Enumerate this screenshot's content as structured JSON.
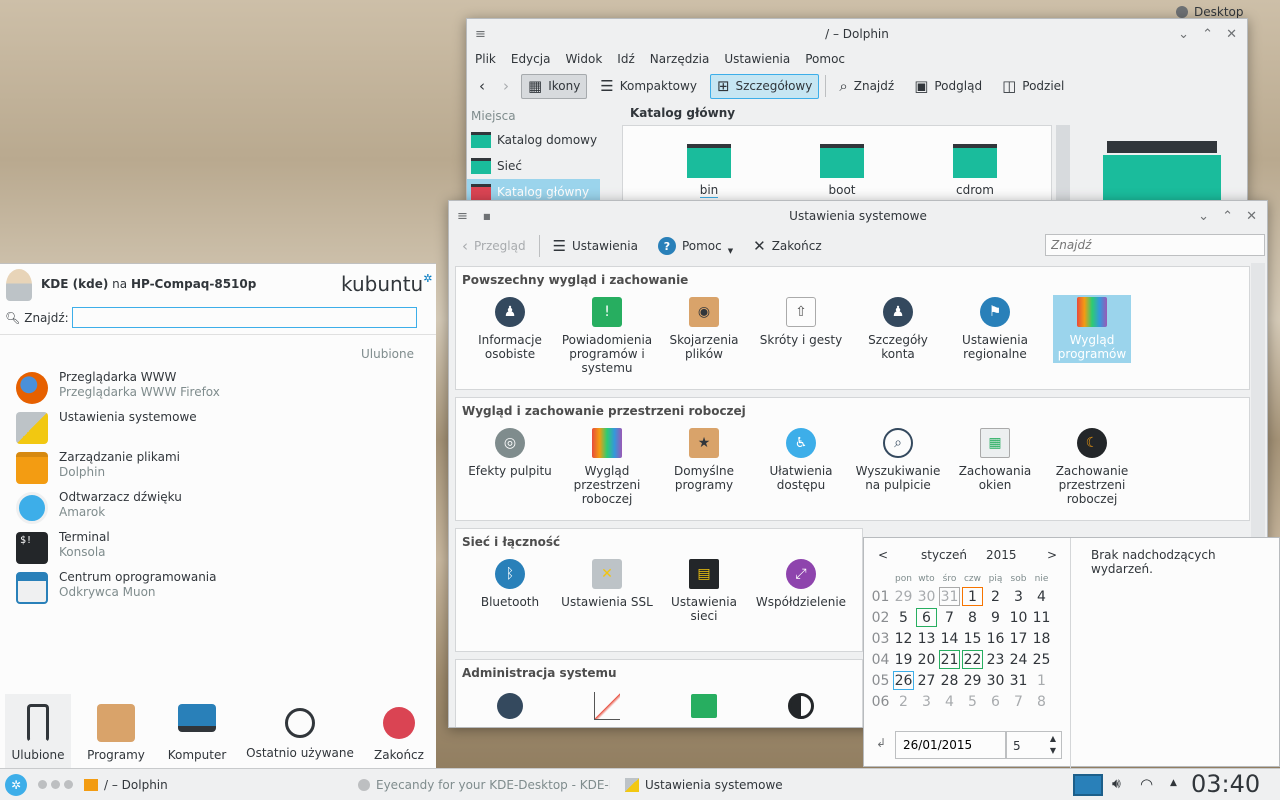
{
  "desktop": {
    "label": "Desktop"
  },
  "dolphin": {
    "title": "/ – Dolphin",
    "menu": [
      "Plik",
      "Edycja",
      "Widok",
      "Idź",
      "Narzędzia",
      "Ustawienia",
      "Pomoc"
    ],
    "toolbar": {
      "icons": "Ikony",
      "compact": "Kompaktowy",
      "details": "Szczegółowy",
      "find": "Znajdź",
      "preview": "Podgląd",
      "split": "Podziel"
    },
    "places_title": "Miejsca",
    "places": [
      "Katalog domowy",
      "Sieć",
      "Katalog główny"
    ],
    "location": "Katalog główny",
    "folders": [
      "bin",
      "boot",
      "cdrom"
    ]
  },
  "settings": {
    "title": "Ustawienia systemowe",
    "toolbar": {
      "overview": "Przegląd",
      "configure": "Ustawienia",
      "help": "Pomoc",
      "quit": "Zakończ"
    },
    "search_placeholder": "Znajdź",
    "sections": [
      {
        "title": "Powszechny wygląd i zachowanie",
        "modules": [
          "Informacje osobiste",
          "Powiadomienia programów i systemu",
          "Skojarzenia plików",
          "Skróty i gesty",
          "Szczegóły konta",
          "Ustawienia regionalne",
          "Wygląd programów"
        ]
      },
      {
        "title": "Wygląd i zachowanie przestrzeni roboczej",
        "modules": [
          "Efekty pulpitu",
          "Wygląd przestrzeni roboczej",
          "Domyślne programy",
          "Ułatwienia dostępu",
          "Wyszukiwanie na pulpicie",
          "Zachowania okien",
          "Zachowanie przestrzeni roboczej"
        ]
      },
      {
        "title": "Sieć i łączność",
        "modules": [
          "Bluetooth",
          "Ustawienia SSL",
          "Ustawienia sieci",
          "Współdzielenie"
        ]
      },
      {
        "title": "Administracja systemu",
        "modules": []
      }
    ]
  },
  "calendar": {
    "prev": "<",
    "next": ">",
    "month": "styczeń",
    "year": "2015",
    "weekdays": [
      "pon",
      "wto",
      "śro",
      "czw",
      "pią",
      "sob",
      "nie"
    ],
    "weeks": [
      {
        "wk": "01",
        "days": [
          "29",
          "30",
          "31",
          "1",
          "2",
          "3",
          "4"
        ]
      },
      {
        "wk": "02",
        "days": [
          "5",
          "6",
          "7",
          "8",
          "9",
          "10",
          "11"
        ]
      },
      {
        "wk": "03",
        "days": [
          "12",
          "13",
          "14",
          "15",
          "16",
          "17",
          "18"
        ]
      },
      {
        "wk": "04",
        "days": [
          "19",
          "20",
          "21",
          "22",
          "23",
          "24",
          "25"
        ]
      },
      {
        "wk": "05",
        "days": [
          "26",
          "27",
          "28",
          "29",
          "30",
          "31",
          "1"
        ]
      },
      {
        "wk": "06",
        "days": [
          "2",
          "3",
          "4",
          "5",
          "6",
          "7",
          "8"
        ]
      }
    ],
    "date_value": "26/01/2015",
    "week_value": "5",
    "no_events": "Brak nadchodzących wydarzeń."
  },
  "launcher": {
    "user": "KDE (kde)",
    "on": "na",
    "host": "HP-Compaq-8510p",
    "brand": "kubuntu",
    "search_label": "Znajdź:",
    "favorites_label": "Ulubione",
    "favorites": [
      {
        "name": "Przeglądarka WWW",
        "desc": "Przeglądarka WWW Firefox",
        "icon": "firefox-icon",
        "color": "#e66000"
      },
      {
        "name": "Ustawienia systemowe",
        "desc": "",
        "icon": "system-settings-icon",
        "color": "#f2c811"
      },
      {
        "name": "Zarządzanie plikami",
        "desc": "Dolphin",
        "icon": "folder-icon",
        "color": "#f39c12"
      },
      {
        "name": "Odtwarzacz dźwięku",
        "desc": "Amarok",
        "icon": "amarok-icon",
        "color": "#3daee9"
      },
      {
        "name": "Terminal",
        "desc": "Konsola",
        "icon": "terminal-icon",
        "color": "#232629"
      },
      {
        "name": "Centrum oprogramowania",
        "desc": "Odkrywca Muon",
        "icon": "muon-icon",
        "color": "#2980b9"
      }
    ],
    "tabs": [
      "Ulubione",
      "Programy",
      "Komputer",
      "Ostatnio używane",
      "Zakończ"
    ]
  },
  "taskbar": {
    "tasks": [
      "/ – Dolphin",
      "Eyecandy for your KDE-Desktop - KDE-Look",
      "Ustawienia systemowe"
    ],
    "clock": "03:40"
  }
}
